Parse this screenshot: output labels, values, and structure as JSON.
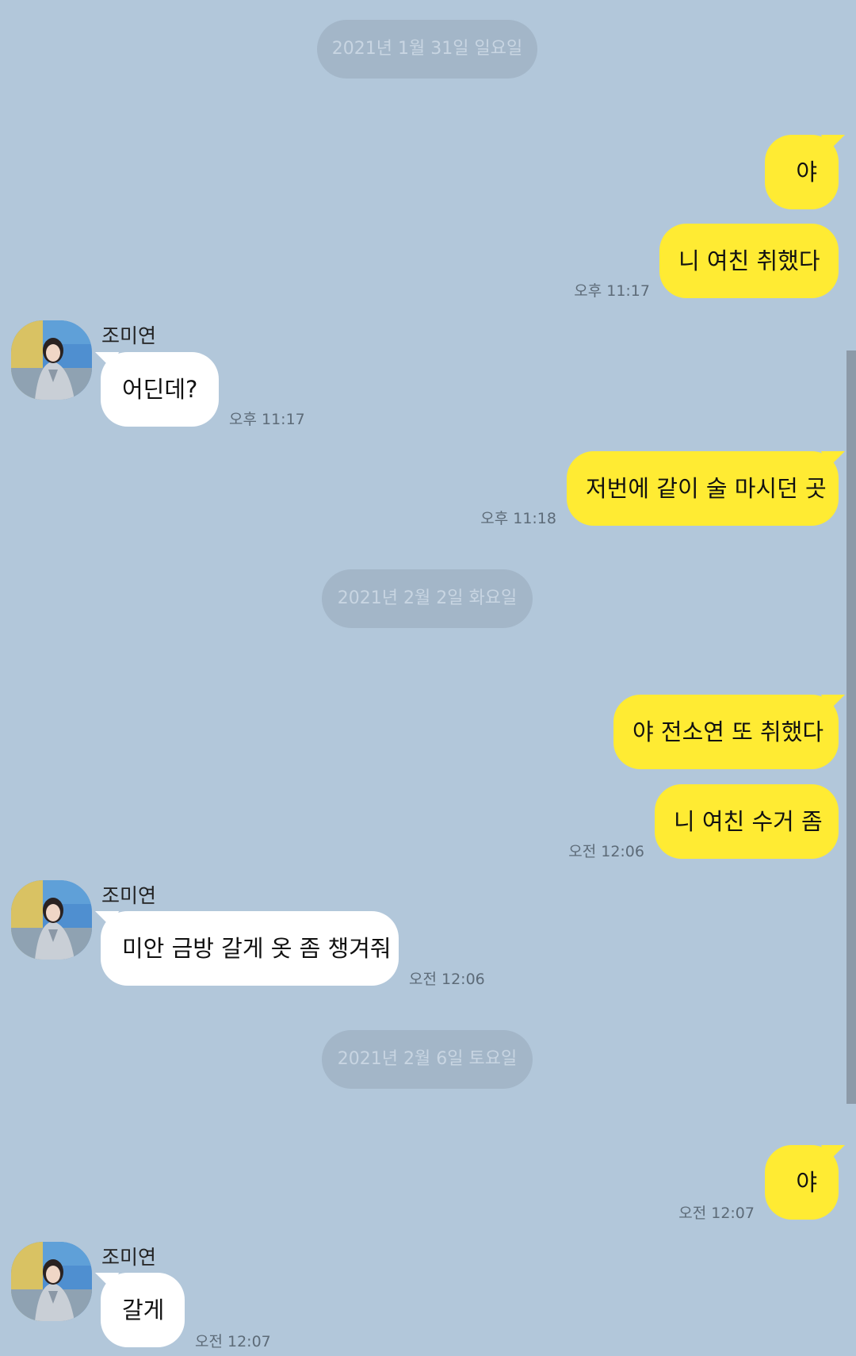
{
  "contact": {
    "name": "조미연",
    "avatar_icon": "profile-photo"
  },
  "colors": {
    "background": "#b2c7da",
    "my_bubble": "#ffeb33",
    "their_bubble": "#ffffff",
    "date_pill": "#a3b6c8"
  },
  "date_separators": [
    "2021년 1월 31일 일요일",
    "2021년 2월 2일 화요일",
    "2021년 2월 6일 토요일"
  ],
  "messages": [
    {
      "sender": "me",
      "text": "야"
    },
    {
      "sender": "me",
      "text": "니 여친 취했다",
      "time": "오후 11:17"
    },
    {
      "sender": "them",
      "name": "조미연",
      "text": "어딘데?",
      "time": "오후 11:17"
    },
    {
      "sender": "me",
      "text": "저번에 같이 술 마시던 곳",
      "time": "오후 11:18"
    },
    {
      "sender": "me",
      "text": "야 전소연 또 취했다"
    },
    {
      "sender": "me",
      "text": "니 여친 수거 좀",
      "time": "오전 12:06"
    },
    {
      "sender": "them",
      "name": "조미연",
      "text": "미안 금방 갈게 옷 좀 챙겨줘",
      "time": "오전 12:06"
    },
    {
      "sender": "me",
      "text": "야",
      "time": "오전 12:07"
    },
    {
      "sender": "them",
      "name": "조미연",
      "text": "갈게",
      "time": "오전 12:07"
    }
  ]
}
